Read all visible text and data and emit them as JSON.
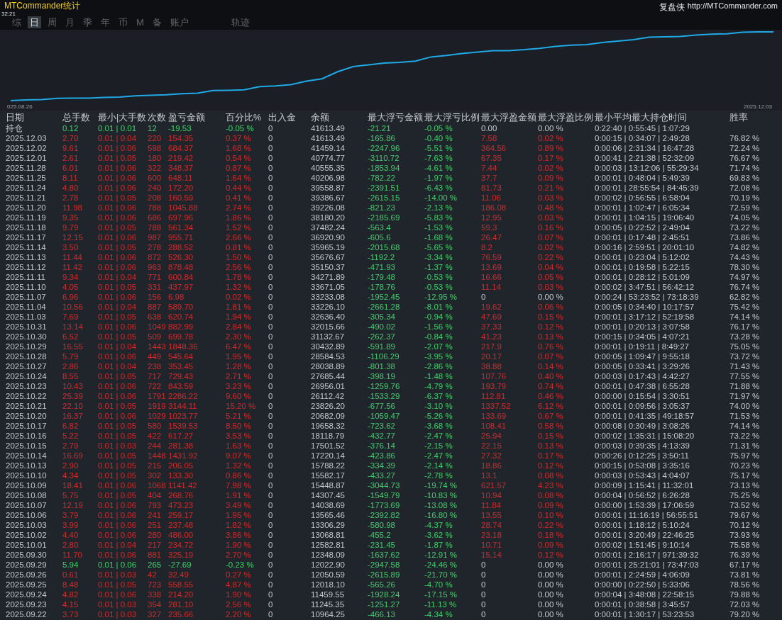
{
  "window": {
    "title": "MTCommander统计",
    "time": "32:21",
    "brand": "复盘侠",
    "link": "http://MTCommander.com"
  },
  "tabs": [
    {
      "label": "综",
      "selected": false
    },
    {
      "label": "日",
      "selected": true
    },
    {
      "label": "周",
      "selected": false
    },
    {
      "label": "月",
      "selected": false
    },
    {
      "label": "季",
      "selected": false
    },
    {
      "label": "年",
      "selected": false
    },
    {
      "label": "币",
      "selected": false
    },
    {
      "label": "M",
      "selected": false
    },
    {
      "label": "备",
      "selected": false
    },
    {
      "label": "账户",
      "selected": false
    },
    {
      "label": "轨迹",
      "selected": false
    }
  ],
  "chart": {
    "start_label": "025.08.26",
    "end_label": "2025.12.03"
  },
  "table": {
    "columns": [
      "日期",
      "总手数",
      "最小|大手数",
      "次数",
      "盈亏金额",
      "百分比%",
      "出入金",
      "余额",
      "最大浮亏金额",
      "最大浮亏比例",
      "最大浮盈金额",
      "最大浮盈比例",
      "最小平均最大持仓时间",
      "胜率"
    ],
    "rows": [
      {
        "kind": "loss",
        "float_profit": false,
        "cells": [
          "持仓",
          "0.12",
          "0.01 | 0.01",
          "12",
          "-19.53",
          "-0.05 %",
          "0",
          "41613.49",
          "-21.21",
          "-0.05 %",
          "0.00",
          "0.00 %",
          "0:22:40 | 0:55:45 | 1:07:29"
        ]
      },
      {
        "kind": "profit",
        "float_profit": true,
        "cells": [
          "2025.12.03",
          "2.70",
          "0.01 | 0.04",
          "220",
          "154.35",
          "0.37 %",
          "0",
          "41613.49",
          "-165.86",
          "-0.40 %",
          "7.58",
          "0.02 %",
          "0:00:15 | 0:34:07 | 2:49:28",
          "76.82 %"
        ]
      },
      {
        "kind": "profit",
        "float_profit": true,
        "cells": [
          "2025.12.02",
          "9.61",
          "0.01 | 0.06",
          "598",
          "684.37",
          "1.68 %",
          "0",
          "41459.14",
          "-2247.96",
          "-5.51 %",
          "364.56",
          "0.89 %",
          "0:00:06 | 2:31:34 | 16:47:28",
          "72.24 %"
        ]
      },
      {
        "kind": "profit",
        "float_profit": true,
        "cells": [
          "2025.12.01",
          "2.61",
          "0.01 | 0.05",
          "180",
          "219.42",
          "0.54 %",
          "0",
          "40774.77",
          "-3110.72",
          "-7.63 %",
          "67.35",
          "0.17 %",
          "0:00:41 | 2:21:38 | 52:32:09",
          "76.67 %"
        ]
      },
      {
        "kind": "profit",
        "float_profit": true,
        "cells": [
          "2025.11.28",
          "6.01",
          "0.01 | 0.06",
          "322",
          "348.37",
          "0.87 %",
          "0",
          "40555.35",
          "-1853.94",
          "-4.61 %",
          "7.44",
          "0.02 %",
          "0:00:03 | 13:12:06 | 55:29:34",
          "71.74 %"
        ]
      },
      {
        "kind": "profit",
        "float_profit": true,
        "cells": [
          "2025.11.25",
          "8.11",
          "0.01 | 0.06",
          "600",
          "648.11",
          "1.64 %",
          "0",
          "40206.98",
          "-782.22",
          "-1.97 %",
          "37.7",
          "0.09 %",
          "0:00:01 | 0:48:04 | 5:49:39",
          "69.83 %"
        ]
      },
      {
        "kind": "profit",
        "float_profit": true,
        "cells": [
          "2025.11.24",
          "4.80",
          "0.01 | 0.06",
          "240",
          "172.20",
          "0.44 %",
          "0",
          "39558.87",
          "-2391.51",
          "-6.43 %",
          "81.73",
          "0.21 %",
          "0:00:01 | 28:55:54 | 84:45:39",
          "72.08 %"
        ]
      },
      {
        "kind": "profit",
        "float_profit": true,
        "cells": [
          "2025.11.21",
          "2.78",
          "0.01 | 0.05",
          "208",
          "160.59",
          "0.41 %",
          "0",
          "39386.67",
          "-2615.15",
          "-14.00 %",
          "11.06",
          "0.03 %",
          "0:00:02 | 0:56:55 | 6:58:04",
          "70.19 %"
        ]
      },
      {
        "kind": "profit",
        "float_profit": true,
        "cells": [
          "2025.11.20",
          "11.98",
          "0.01 | 0.06",
          "788",
          "1045.88",
          "2.74 %",
          "0",
          "39226.08",
          "-821.23",
          "-2.13 %",
          "186.08",
          "0.48 %",
          "0:00:01 | 1:02:47 | 6:05:34",
          "72.59 %"
        ]
      },
      {
        "kind": "profit",
        "float_profit": true,
        "cells": [
          "2025.11.19",
          "9.35",
          "0.01 | 0.06",
          "686",
          "697.96",
          "1.86 %",
          "0",
          "38180.20",
          "-2185.69",
          "-5.83 %",
          "12.95",
          "0.03 %",
          "0:00:01 | 1:04:15 | 19:06:40",
          "74.05 %"
        ]
      },
      {
        "kind": "profit",
        "float_profit": true,
        "cells": [
          "2025.11.18",
          "9.79",
          "0.01 | 0.05",
          "788",
          "561.34",
          "1.52 %",
          "0",
          "37482.24",
          "-563.4",
          "-1.53 %",
          "59.3",
          "0.16 %",
          "0:00:05 | 0:22:52 | 2:49:04",
          "73.22 %"
        ]
      },
      {
        "kind": "profit",
        "float_profit": true,
        "cells": [
          "2025.11.17",
          "12.15",
          "0.01 | 0.06",
          "987",
          "955.71",
          "2.66 %",
          "0",
          "36920.90",
          "-605.6",
          "-1.68 %",
          "26.47",
          "0.07 %",
          "0:00:01 | 0:17:48 | 2:45:51",
          "73.86 %"
        ]
      },
      {
        "kind": "profit",
        "float_profit": true,
        "cells": [
          "2025.11.14",
          "3.50",
          "0.01 | 0.05",
          "278",
          "288.52",
          "0.81 %",
          "0",
          "35965.19",
          "-2015.68",
          "-5.65 %",
          "8.2",
          "0.02 %",
          "0:00:16 | 2:59:51 | 20:01:10",
          "74.82 %"
        ]
      },
      {
        "kind": "profit",
        "float_profit": true,
        "cells": [
          "2025.11.13",
          "11.44",
          "0.01 | 0.06",
          "872",
          "526.30",
          "1.50 %",
          "0",
          "35676.67",
          "-1192.2",
          "-3.34 %",
          "76.59",
          "0.22 %",
          "0:00:01 | 0:23:04 | 5:12:02",
          "74.43 %"
        ]
      },
      {
        "kind": "profit",
        "float_profit": true,
        "cells": [
          "2025.11.12",
          "11.42",
          "0.01 | 0.06",
          "963",
          "878.48",
          "2.56 %",
          "0",
          "35150.37",
          "-471.93",
          "-1.37 %",
          "13.69",
          "0.04 %",
          "0:00:01 | 0:19:58 | 5:22:15",
          "78.30 %"
        ]
      },
      {
        "kind": "profit",
        "float_profit": true,
        "cells": [
          "2025.11.11",
          "9.34",
          "0.01 | 0.04",
          "771",
          "600.84",
          "1.78 %",
          "0",
          "34271.89",
          "-179.48",
          "-0.53 %",
          "16.66",
          "0.05 %",
          "0:00:01 | 0:28:12 | 5:01:09",
          "74.97 %"
        ]
      },
      {
        "kind": "profit",
        "float_profit": true,
        "cells": [
          "2025.11.10",
          "4.05",
          "0.01 | 0.05",
          "331",
          "437.97",
          "1.32 %",
          "0",
          "33671.05",
          "-178.76",
          "-0.53 %",
          "11.14",
          "0.03 %",
          "0:00:02 | 3:47:51 | 56:42:12",
          "76.74 %"
        ]
      },
      {
        "kind": "profit",
        "float_profit": false,
        "cells": [
          "2025.11.07",
          "6.96",
          "0.01 | 0.06",
          "156",
          "6.98",
          "0.02 %",
          "0",
          "33233.08",
          "-1952.45",
          "-12.95 %",
          "0",
          "0.00 %",
          "0:00:24 | 53:23:52 | 73:18:39",
          "62.82 %"
        ]
      },
      {
        "kind": "profit",
        "float_profit": true,
        "cells": [
          "2025.11.04",
          "10.56",
          "0.01 | 0.04",
          "887",
          "589.70",
          "1.81 %",
          "0",
          "33226.10",
          "-2661.28",
          "-8.01 %",
          "19.62",
          "0.06 %",
          "0:00:05 | 0:34:40 | 10:17:57",
          "75.42 %"
        ]
      },
      {
        "kind": "profit",
        "float_profit": true,
        "cells": [
          "2025.11.03",
          "7.69",
          "0.01 | 0.05",
          "638",
          "620.74",
          "1.94 %",
          "0",
          "32636.40",
          "-305.34",
          "-0.94 %",
          "47.69",
          "0.15 %",
          "0:00:01 | 3:17:12 | 52:19:58",
          "74.14 %"
        ]
      },
      {
        "kind": "profit",
        "float_profit": true,
        "cells": [
          "2025.10.31",
          "13.14",
          "0.01 | 0.06",
          "1049",
          "882.99",
          "2.84 %",
          "0",
          "32015.66",
          "-490.02",
          "-1.56 %",
          "37.33",
          "0.12 %",
          "0:00:01 | 0:20:13 | 3:07:58",
          "76.17 %"
        ]
      },
      {
        "kind": "profit",
        "float_profit": true,
        "cells": [
          "2025.10.30",
          "6.52",
          "0.01 | 0.05",
          "509",
          "699.78",
          "2.30 %",
          "0",
          "31132.67",
          "-262.37",
          "-0.84 %",
          "41.23",
          "0.13 %",
          "0:00:15 | 0:34:05 | 4:07:21",
          "73.28 %"
        ]
      },
      {
        "kind": "profit",
        "float_profit": true,
        "cells": [
          "2025.10.29",
          "16.55",
          "0.01 | 0.04",
          "1443",
          "1848.36",
          "6.47 %",
          "0",
          "30432.89",
          "-591.89",
          "-2.07 %",
          "217.9",
          "0.76 %",
          "0:00:01 | 0:19:11 | 8:49:27",
          "75.05 %"
        ]
      },
      {
        "kind": "profit",
        "float_profit": true,
        "cells": [
          "2025.10.28",
          "5.79",
          "0.01 | 0.06",
          "449",
          "545.64",
          "1.95 %",
          "0",
          "28584.53",
          "-1106.29",
          "-3.95 %",
          "20.17",
          "0.07 %",
          "0:00:05 | 1:09:47 | 9:55:18",
          "73.72 %"
        ]
      },
      {
        "kind": "profit",
        "float_profit": true,
        "cells": [
          "2025.10.27",
          "2.86",
          "0.01 | 0.04",
          "238",
          "353.45",
          "1.28 %",
          "0",
          "28038.89",
          "-801.38",
          "-2.86 %",
          "38.88",
          "0.14 %",
          "0:00:05 | 0:33:41 | 3:29:26",
          "71.43 %"
        ]
      },
      {
        "kind": "profit",
        "float_profit": true,
        "cells": [
          "2025.10.24",
          "8.55",
          "0.01 | 0.05",
          "717",
          "729.43",
          "2.71 %",
          "0",
          "27685.44",
          "-398.19",
          "-1.48 %",
          "107.76",
          "0.40 %",
          "0:00:03 | 0:17:43 | 4:42:27",
          "77.55 %"
        ]
      },
      {
        "kind": "profit",
        "float_profit": true,
        "cells": [
          "2025.10.23",
          "10.43",
          "0.01 | 0.06",
          "722",
          "843.59",
          "3.23 %",
          "0",
          "26956.01",
          "-1259.76",
          "-4.79 %",
          "193.79",
          "0.74 %",
          "0:00:01 | 0:47:38 | 6:55:28",
          "71.88 %"
        ]
      },
      {
        "kind": "profit",
        "float_profit": true,
        "cells": [
          "2025.10.22",
          "25.39",
          "0.01 | 0.06",
          "1791",
          "2286.22",
          "9.60 %",
          "0",
          "26112.42",
          "-1533.29",
          "-6.37 %",
          "112.81",
          "0.46 %",
          "0:00:00 | 0:15:54 | 3:30:51",
          "71.97 %"
        ]
      },
      {
        "kind": "profit",
        "float_profit": true,
        "cells": [
          "2025.10.21",
          "22.10",
          "0.01 | 0.05",
          "1919",
          "3144.11",
          "15.20 %",
          "0",
          "23826.20",
          "-677.56",
          "-3.10 %",
          "1337.52",
          "6.12 %",
          "0:00:01 | 0:09:56 | 3:05:37",
          "74.00 %"
        ]
      },
      {
        "kind": "profit",
        "float_profit": true,
        "cells": [
          "2025.10.20",
          "16.37",
          "0.01 | 0.06",
          "1029",
          "1023.77",
          "5.21 %",
          "0",
          "20682.09",
          "-1059.47",
          "-5.26 %",
          "133.69",
          "0.67 %",
          "0:00:01 | 0:41:35 | 49:18:57",
          "71.53 %"
        ]
      },
      {
        "kind": "profit",
        "float_profit": true,
        "cells": [
          "2025.10.17",
          "6.82",
          "0.01 | 0.05",
          "580",
          "1539.53",
          "8.50 %",
          "0",
          "19658.32",
          "-723.62",
          "-3.68 %",
          "108.41",
          "0.58 %",
          "0:00:08 | 0:30:49 | 3:08:26",
          "74.14 %"
        ]
      },
      {
        "kind": "profit",
        "float_profit": true,
        "cells": [
          "2025.10.16",
          "5.22",
          "0.01 | 0.05",
          "422",
          "617.27",
          "3.53 %",
          "0",
          "18118.79",
          "-432.77",
          "-2.47 %",
          "25.94",
          "0.15 %",
          "0:00:02 | 1:35:31 | 15:08:20",
          "73.22 %"
        ]
      },
      {
        "kind": "profit",
        "float_profit": true,
        "cells": [
          "2025.10.15",
          "2.79",
          "0.01 | 0.03",
          "244",
          "281.38",
          "1.63 %",
          "0",
          "17501.52",
          "-376.14",
          "-2.15 %",
          "22.15",
          "0.13 %",
          "0:00:03 | 0:39:35 | 4:13:39",
          "71.31 %"
        ]
      },
      {
        "kind": "profit",
        "float_profit": true,
        "cells": [
          "2025.10.14",
          "16.69",
          "0.01 | 0.05",
          "1448",
          "1431.92",
          "9.07 %",
          "0",
          "17220.14",
          "-423.86",
          "-2.47 %",
          "27.32",
          "0.17 %",
          "0:00:26 | 0:12:25 | 3:50:11",
          "75.97 %"
        ]
      },
      {
        "kind": "profit",
        "float_profit": true,
        "cells": [
          "2025.10.13",
          "2.90",
          "0.01 | 0.05",
          "215",
          "206.05",
          "1.32 %",
          "0",
          "15788.22",
          "-334.39",
          "-2.14 %",
          "18.86",
          "0.12 %",
          "0:00:15 | 0:53:08 | 3:35:16",
          "70.23 %"
        ]
      },
      {
        "kind": "profit",
        "float_profit": true,
        "cells": [
          "2025.10.10",
          "4.34",
          "0.01 | 0.05",
          "302",
          "133.30",
          "0.86 %",
          "0",
          "15582.17",
          "-433.27",
          "-2.78 %",
          "13.1",
          "0.08 %",
          "0:00:03 | 0:53:43 | 4:04:07",
          "75.17 %"
        ]
      },
      {
        "kind": "profit",
        "float_profit": true,
        "cells": [
          "2025.10.09",
          "18.41",
          "0.01 | 0.06",
          "1068",
          "1141.42",
          "7.98 %",
          "0",
          "15448.87",
          "-3044.73",
          "-19.74 %",
          "621.57",
          "4.23 %",
          "0:00:09 | 1:15:41 | 11:32:01",
          "73.13 %"
        ]
      },
      {
        "kind": "profit",
        "float_profit": true,
        "cells": [
          "2025.10.08",
          "5.75",
          "0.01 | 0.05",
          "404",
          "268.76",
          "1.91 %",
          "0",
          "14307.45",
          "-1549.79",
          "-10.83 %",
          "10.94",
          "0.08 %",
          "0:00:04 | 0:56:52 | 6:26:28",
          "75.25 %"
        ]
      },
      {
        "kind": "profit",
        "float_profit": true,
        "cells": [
          "2025.10.07",
          "12.19",
          "0.01 | 0.06",
          "793",
          "473.23",
          "3.49 %",
          "0",
          "14038.69",
          "-1773.69",
          "-13.08 %",
          "11.84",
          "0.09 %",
          "0:00:00 | 1:53:39 | 17:06:59",
          "73.52 %"
        ]
      },
      {
        "kind": "profit",
        "float_profit": true,
        "cells": [
          "2025.10.06",
          "3.79",
          "0.01 | 0.06",
          "241",
          "259.17",
          "1.95 %",
          "0",
          "13565.46",
          "-2392.82",
          "-16.80 %",
          "13.55",
          "0.10 %",
          "0:00:01 | 11:16:19 | 56:55:51",
          "79.67 %"
        ]
      },
      {
        "kind": "profit",
        "float_profit": true,
        "cells": [
          "2025.10.03",
          "3.99",
          "0.01 | 0.06",
          "251",
          "237.48",
          "1.82 %",
          "0",
          "13306.29",
          "-580.98",
          "-4.37 %",
          "28.74",
          "0.22 %",
          "0:00:01 | 1:18:12 | 5:10:24",
          "70.12 %"
        ]
      },
      {
        "kind": "profit",
        "float_profit": true,
        "cells": [
          "2025.10.02",
          "4.40",
          "0.01 | 0.06",
          "280",
          "486.00",
          "3.86 %",
          "0",
          "13068.81",
          "-455.2",
          "-3.62 %",
          "23.18",
          "0.18 %",
          "0:00:01 | 3:20:49 | 22:46:25",
          "73.93 %"
        ]
      },
      {
        "kind": "profit",
        "float_profit": true,
        "cells": [
          "2025.10.01",
          "2.80",
          "0.01 | 0.04",
          "217",
          "234.72",
          "1.90 %",
          "0",
          "12582.81",
          "-231.45",
          "-1.87 %",
          "10.71",
          "0.09 %",
          "0:00:02 | 1:51:45 | 9:10:14",
          "75.58 %"
        ]
      },
      {
        "kind": "profit",
        "float_profit": true,
        "cells": [
          "2025.09.30",
          "11.70",
          "0.01 | 0.06",
          "881",
          "325.19",
          "2.70 %",
          "0",
          "12348.09",
          "-1637.62",
          "-12.91 %",
          "15.14",
          "0.12 %",
          "0:00:01 | 2:16:17 | 971:39:32",
          "76.39 %"
        ]
      },
      {
        "kind": "loss",
        "float_profit": false,
        "cells": [
          "2025.09.29",
          "5.94",
          "0.01 | 0.06",
          "265",
          "-27.69",
          "-0.23 %",
          "0",
          "12022.90",
          "-2947.58",
          "-24.46 %",
          "0",
          "0.00 %",
          "0:00:01 | 25:21:01 | 73:47:03",
          "67.17 %"
        ]
      },
      {
        "kind": "profit",
        "float_profit": false,
        "cells": [
          "2025.09.26",
          "0.61",
          "0.01 | 0.03",
          "42",
          "32.49",
          "0.27 %",
          "0",
          "12050.59",
          "-2615.89",
          "-21.70 %",
          "0",
          "0.00 %",
          "0:00:01 | 2:24:59 | 4:06:09",
          "73.81 %"
        ]
      },
      {
        "kind": "profit",
        "float_profit": false,
        "cells": [
          "2025.09.25",
          "8.48",
          "0.01 | 0.05",
          "723",
          "558.55",
          "4.87 %",
          "0",
          "12018.10",
          "-565.26",
          "-4.70 %",
          "0",
          "0.00 %",
          "0:00:00 | 0:22:50 | 5:33:06",
          "78.56 %"
        ]
      },
      {
        "kind": "profit",
        "float_profit": false,
        "cells": [
          "2025.09.24",
          "4.82",
          "0.01 | 0.06",
          "338",
          "214.20",
          "1.90 %",
          "0",
          "11459.55",
          "-1928.24",
          "-17.15 %",
          "0",
          "0.00 %",
          "0:00:04 | 3:48:08 | 22:58:15",
          "79.88 %"
        ]
      },
      {
        "kind": "profit",
        "float_profit": false,
        "cells": [
          "2025.09.23",
          "4.15",
          "0.01 | 0.03",
          "354",
          "281.10",
          "2.56 %",
          "0",
          "11245.35",
          "-1251.27",
          "-11.13 %",
          "0",
          "0.00 %",
          "0:00:01 | 0:38:58 | 3:45:57",
          "72.03 %"
        ]
      },
      {
        "kind": "profit",
        "float_profit": false,
        "cells": [
          "2025.09.22",
          "3.73",
          "0.01 | 0.03",
          "327",
          "235.66",
          "2.20 %",
          "0",
          "10964.25",
          "-466.13",
          "-4.34 %",
          "0",
          "0.00 %",
          "0:00:01 | 1:30:17 | 53:23:53",
          "79.20 %"
        ]
      }
    ]
  }
}
